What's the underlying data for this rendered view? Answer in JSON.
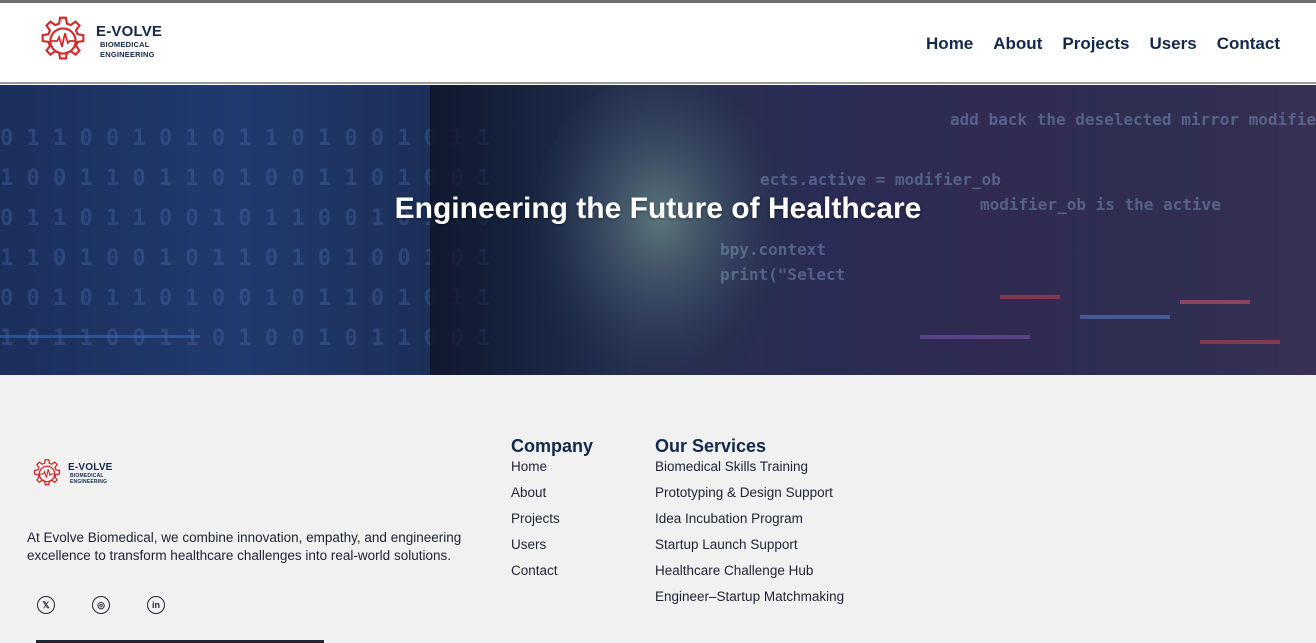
{
  "brand": {
    "name": "E-VOLVE",
    "sub1": "BIOMEDICAL",
    "sub2": "ENGINEERING",
    "colors": {
      "navy": "#13294b",
      "red": "#d12a2a"
    }
  },
  "nav": {
    "items": [
      {
        "label": "Home"
      },
      {
        "label": "About"
      },
      {
        "label": "Projects"
      },
      {
        "label": "Users"
      },
      {
        "label": "Contact"
      }
    ]
  },
  "hero": {
    "title": "Engineering the Future of Healthcare"
  },
  "footer": {
    "description": "At Evolve Biomedical, we combine innovation, empathy, and engineering excellence to transform healthcare challenges into real-world solutions.",
    "social": [
      {
        "icon": "x-icon",
        "glyph": "𝕏"
      },
      {
        "icon": "instagram-icon",
        "glyph": "◎"
      },
      {
        "icon": "linkedin-icon",
        "glyph": "in"
      }
    ],
    "company": {
      "heading": "Company",
      "links": [
        "Home",
        "About",
        "Projects",
        "Users",
        "Contact"
      ]
    },
    "services": {
      "heading": "Our Services",
      "links": [
        "Biomedical Skills Training",
        "Prototyping & Design Support",
        "Idea Incubation Program",
        "Startup Launch Support",
        "Healthcare Challenge Hub",
        "Engineer–Startup Matchmaking"
      ]
    }
  }
}
